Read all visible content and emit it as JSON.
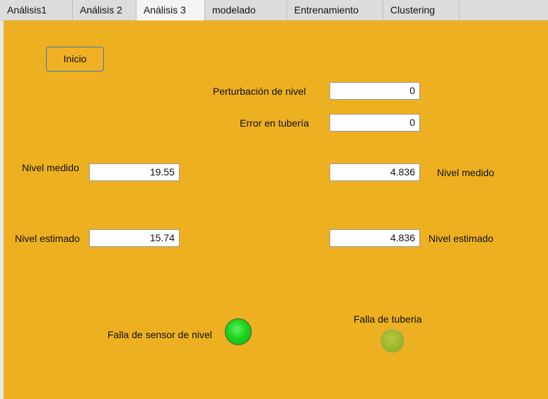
{
  "tabs": [
    {
      "label": "Análisis1",
      "active": false
    },
    {
      "label": "Análisis 2",
      "active": false
    },
    {
      "label": "Análisis 3",
      "active": true
    },
    {
      "label": "modelado",
      "active": false
    },
    {
      "label": "Entrenamiento",
      "active": false
    },
    {
      "label": "Clustering",
      "active": false
    }
  ],
  "colors": {
    "panel_background": "#edb020",
    "lamp_on": "#1ed31e",
    "lamp_off": "#9cb42a"
  },
  "controls": {
    "inicio_button": "Inicio",
    "perturbacion_label": "Perturbación de nivel",
    "perturbacion_value": "0",
    "error_tuberia_label": "Error en tubería",
    "error_tuberia_value": "0"
  },
  "left": {
    "nivel_medido_label": "Nivel medido",
    "nivel_medido_value": "19.55",
    "nivel_estimado_label": "Nivel estimado",
    "nivel_estimado_value": "15.74"
  },
  "right": {
    "nivel_medido_label": "Nivel medido",
    "nivel_medido_value": "4.836",
    "nivel_estimado_label": "Nivel estimado",
    "nivel_estimado_value": "4.836"
  },
  "lamps": {
    "sensor_label": "Falla de sensor de nivel",
    "sensor_state": "on",
    "tuberia_label": "Falla de tuberia",
    "tuberia_state": "off"
  }
}
